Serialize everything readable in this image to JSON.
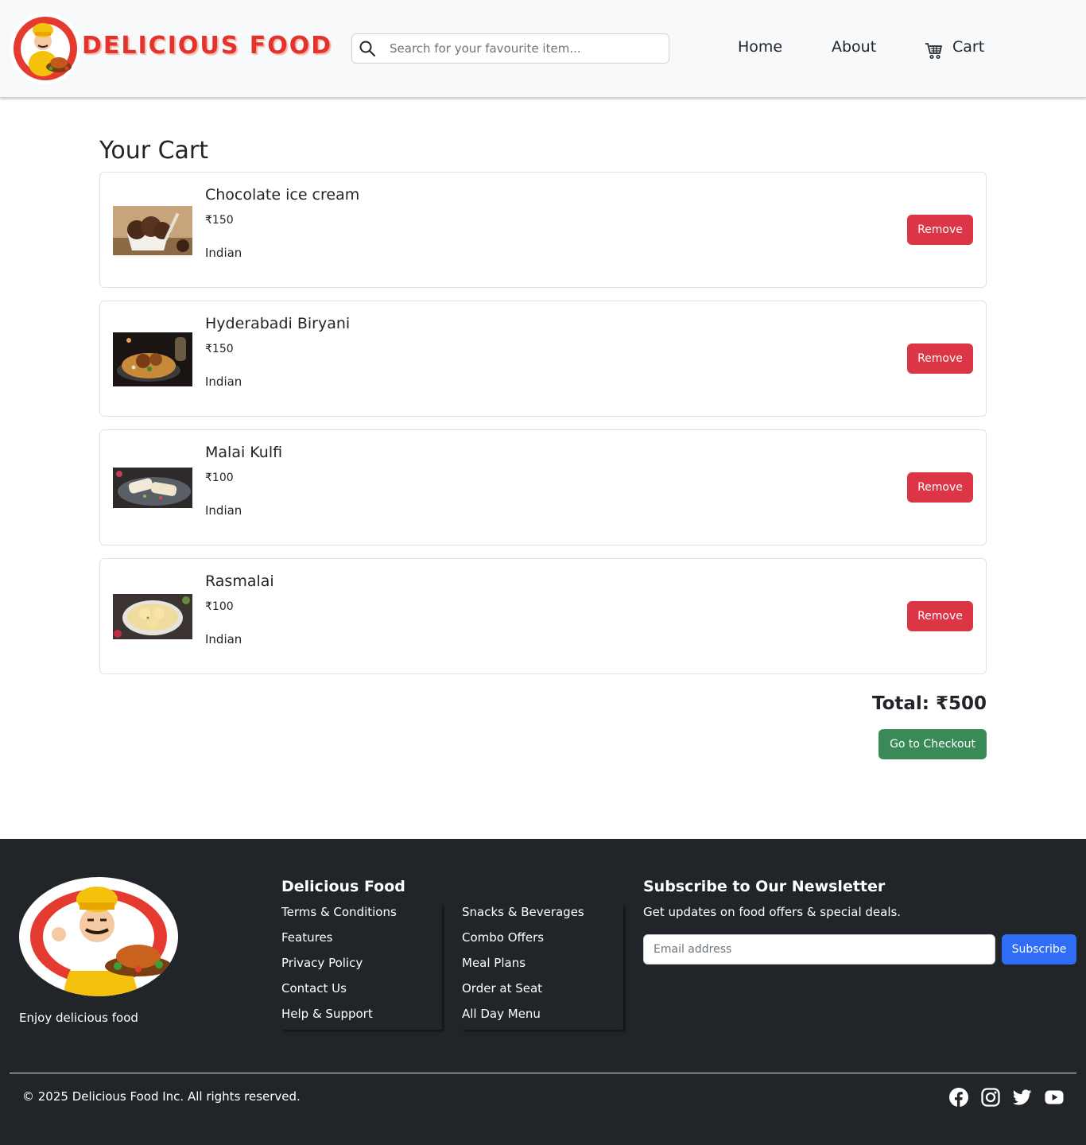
{
  "header": {
    "brand_name": "DELICIOUS FOOD",
    "search_placeholder": "Search for your favourite item...",
    "nav": {
      "home": "Home",
      "about": "About",
      "cart": "Cart"
    }
  },
  "cart": {
    "title": "Your Cart",
    "items": [
      {
        "name": "Chocolate ice cream",
        "price": "₹150",
        "cuisine": "Indian",
        "remove_label": "Remove"
      },
      {
        "name": "Hyderabadi Biryani",
        "price": "₹150",
        "cuisine": "Indian",
        "remove_label": "Remove"
      },
      {
        "name": "Malai Kulfi",
        "price": "₹100",
        "cuisine": "Indian",
        "remove_label": "Remove"
      },
      {
        "name": "Rasmalai",
        "price": "₹100",
        "cuisine": "Indian",
        "remove_label": "Remove"
      }
    ],
    "total": "Total: ₹500",
    "checkout_label": "Go to Checkout"
  },
  "footer": {
    "tagline": "Enjoy delicious food",
    "links_heading": "Delicious Food",
    "links_col1": [
      "Terms & Conditions",
      "Features",
      "Privacy Policy",
      "Contact Us",
      "Help & Support"
    ],
    "links_col2": [
      "Snacks & Beverages",
      "Combo Offers",
      "Meal Plans",
      "Order at Seat",
      "All Day Menu"
    ],
    "newsletter_heading": "Subscribe to Our Newsletter",
    "newsletter_desc": "Get updates on food offers & special deals.",
    "email_placeholder": "Email address",
    "subscribe_label": "Subscribe",
    "copyright": "© 2025 Delicious Food Inc. All rights reserved.",
    "social_icons": [
      "facebook-icon",
      "instagram-icon",
      "twitter-icon",
      "youtube-icon"
    ]
  },
  "colors": {
    "brand_red": "#e2342d",
    "remove_red": "#dc3545",
    "checkout_green": "#3a8a57",
    "subscribe_blue": "#2f6df6",
    "footer_bg": "#212529"
  }
}
